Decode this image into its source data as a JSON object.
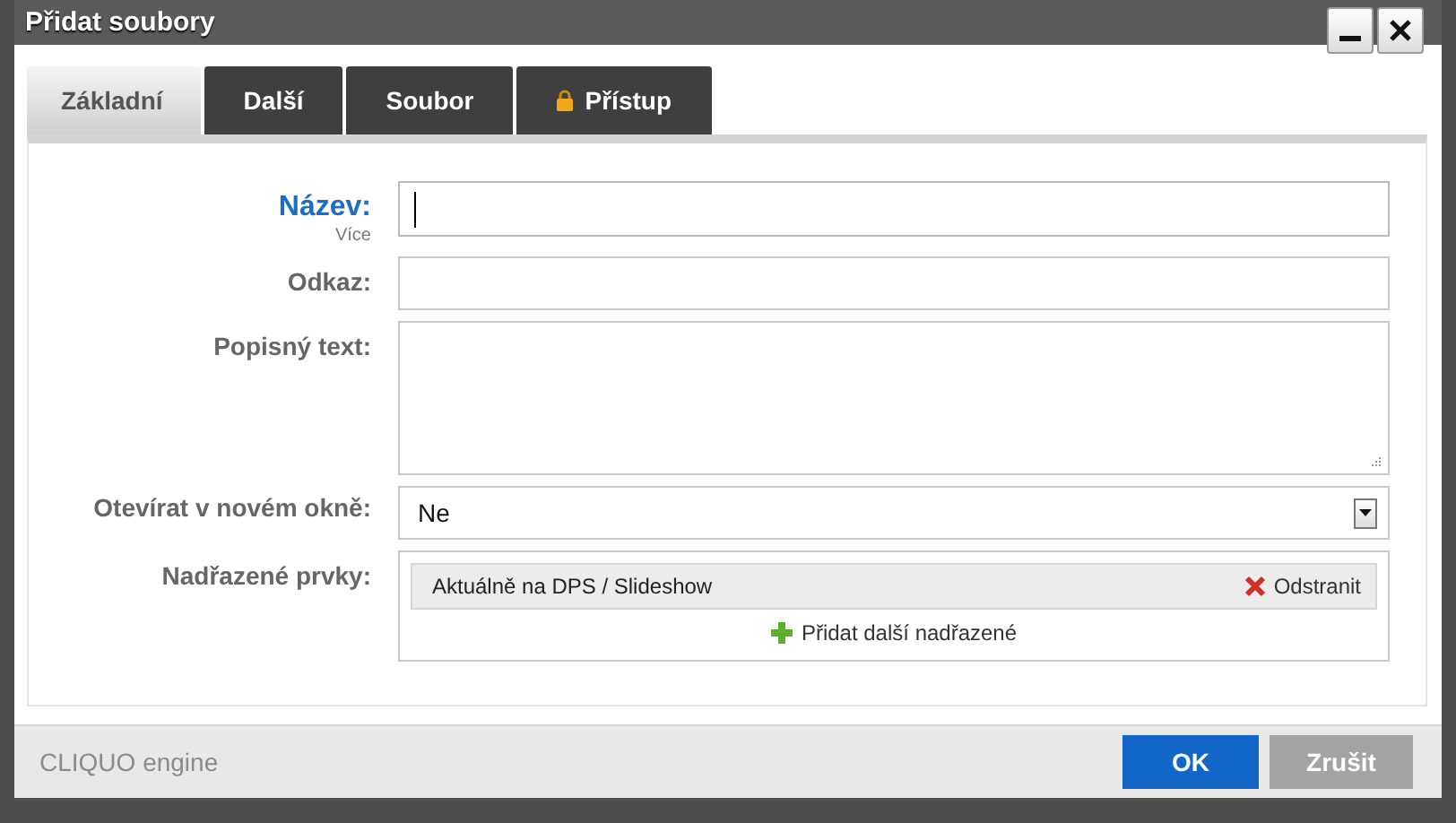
{
  "window": {
    "title": "Přidat soubory"
  },
  "tabs": [
    {
      "label": "Základní",
      "selected": true,
      "kind": "plain"
    },
    {
      "label": "Další",
      "selected": false,
      "kind": "plain"
    },
    {
      "label": "Soubor",
      "selected": false,
      "kind": "plain"
    },
    {
      "label": "Přístup",
      "selected": false,
      "kind": "locked"
    }
  ],
  "fields": [
    {
      "kind": "text",
      "label": "Název:",
      "sublabel": "Více",
      "required": true,
      "focused": true
    },
    {
      "kind": "text",
      "label": "Odkaz:",
      "required": false,
      "focused": false
    },
    {
      "kind": "textarea",
      "label": "Popisný text:",
      "required": false
    },
    {
      "kind": "select",
      "label": "Otevírat v novém okně:",
      "value": "Ne",
      "required": false
    },
    {
      "kind": "parents",
      "label": "Nadřazené prvky:",
      "required": false,
      "items": [
        {
          "label": "Aktuálně na DPS / Slideshow",
          "action": "Odstranit"
        }
      ],
      "add": "Přidat další nadřazené"
    }
  ],
  "footer": {
    "brand": "CLIQUO engine",
    "buttons": [
      {
        "label": "OK",
        "kind": "primary"
      },
      {
        "label": "Zrušit",
        "kind": "secondary"
      }
    ]
  }
}
